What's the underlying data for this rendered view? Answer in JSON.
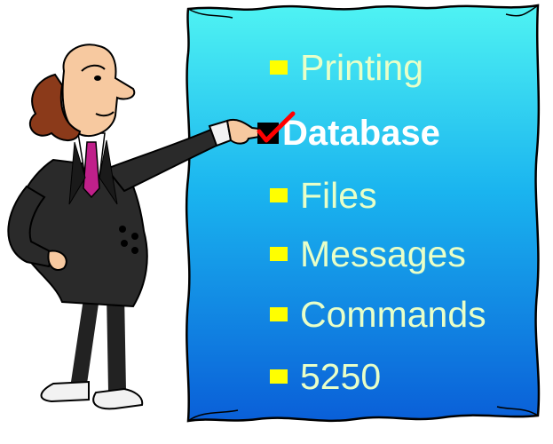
{
  "colors": {
    "board_top": "#4ff3f3",
    "board_bottom": "#0a5fd8",
    "bullet": "#ffff00",
    "item_text": "#e8ffc8",
    "active_text": "#ffffff",
    "check": "#ff0000",
    "suit": "#2a2a2a",
    "tie": "#c0208a"
  },
  "menu": {
    "items": [
      {
        "label": "Printing",
        "icon": "bullet-square-icon"
      },
      {
        "label": "Database",
        "icon": "checkbox-checked-icon",
        "selected": true
      },
      {
        "label": "Files",
        "icon": "bullet-square-icon"
      },
      {
        "label": "Messages",
        "icon": "bullet-square-icon"
      },
      {
        "label": "Commands",
        "icon": "bullet-square-icon"
      },
      {
        "label": "5250",
        "icon": "bullet-square-icon"
      }
    ]
  }
}
